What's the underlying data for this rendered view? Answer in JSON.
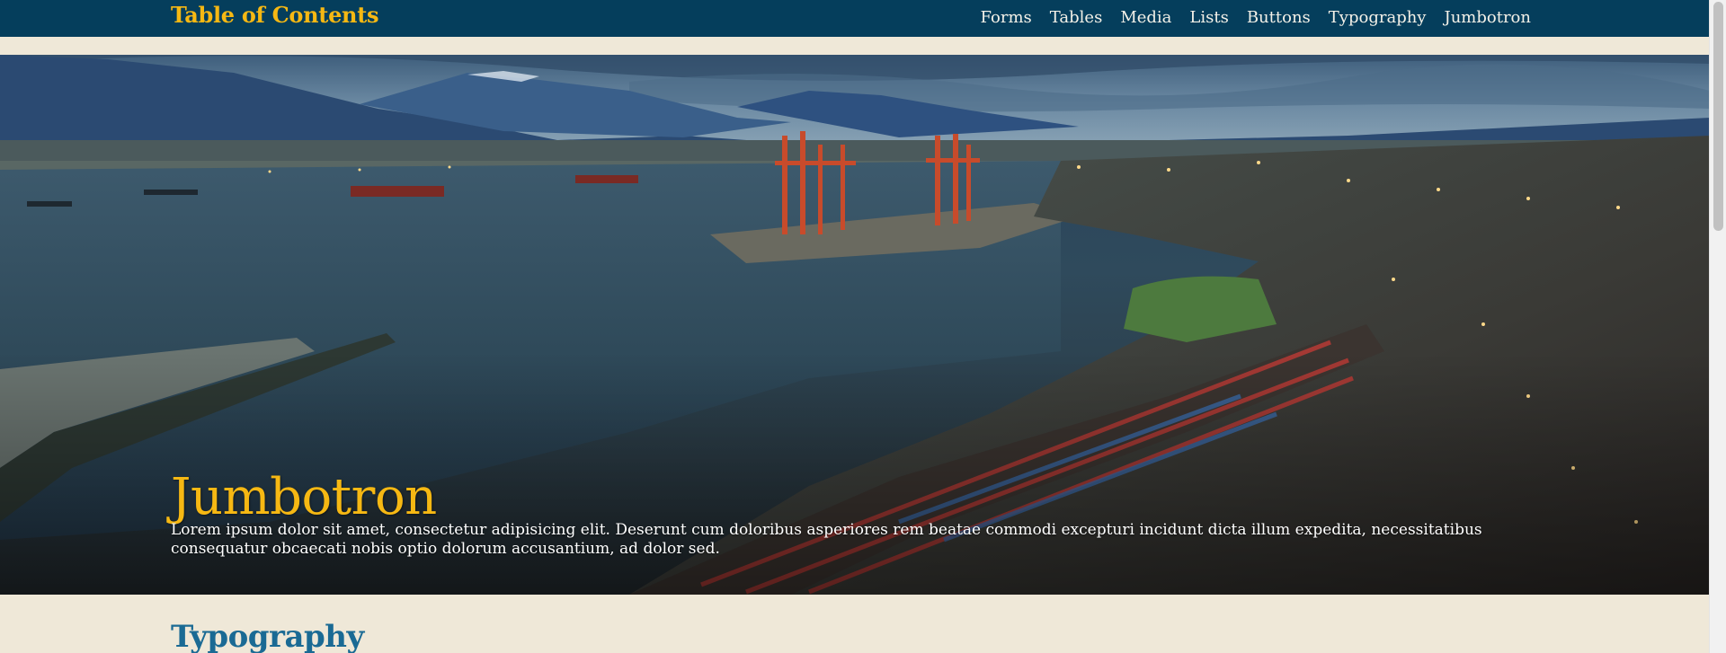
{
  "navbar": {
    "brand": "Table of Contents",
    "links": [
      {
        "label": "Forms"
      },
      {
        "label": "Tables"
      },
      {
        "label": "Media"
      },
      {
        "label": "Lists"
      },
      {
        "label": "Buttons"
      },
      {
        "label": "Typography"
      },
      {
        "label": "Jumbotron"
      }
    ]
  },
  "jumbotron": {
    "title": "Jumbotron",
    "text": "Lorem ipsum dolor sit amet, consectetur adipisicing elit. Deserunt cum doloribus asperiores rem beatae commodi excepturi incidunt dicta illum expedita, necessitatibus consequatur obcaecati nobis optio dolorum accusantium, ad dolor sed.",
    "image_icon": "harbor-city-photo"
  },
  "section": {
    "title": "Typography"
  },
  "colors": {
    "navbar_bg": "#053e5c",
    "accent": "#f6b813",
    "page_bg": "#efe8d8",
    "heading": "#1a6a94"
  }
}
